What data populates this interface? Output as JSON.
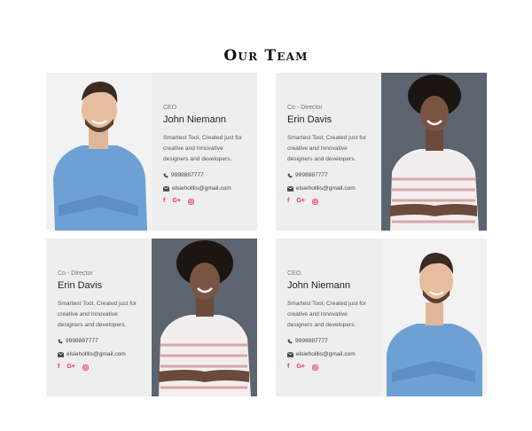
{
  "header": {
    "title": "Our Team"
  },
  "members": [
    {
      "role": "CEO",
      "name": "John Niemann",
      "description": "Smartest Tool, Created just for creative and Innovative designers and developers.",
      "phone": "9998887777",
      "email": "elsieholllis@gmail.com",
      "social": [
        "f",
        "G+",
        "instagram-icon"
      ]
    },
    {
      "role": "Co - Director",
      "name": "Erin Davis",
      "description": "Smartest Tool, Created just for creative and Innovative designers and developers.",
      "phone": "9998887777",
      "email": "elsieholllis@gmail.com",
      "social": [
        "f",
        "G+",
        "instagram-icon"
      ]
    },
    {
      "role": "Co - Director",
      "name": "Erin Davis",
      "description": "Smartest Tool, Created just for creative and Innovative designers and developers.",
      "phone": "9998887777",
      "email": "elsieholllis@gmail.com",
      "social": [
        "f",
        "G+",
        "instagram-icon"
      ]
    },
    {
      "role": "CEO",
      "name": "John Niemann",
      "description": "Smartest Tool, Created just for creative and Innovative designers and developers.",
      "phone": "9998887777",
      "email": "elsieholllis@gmail.com",
      "social": [
        "f",
        "G+",
        "instagram-icon"
      ]
    }
  ],
  "colors": {
    "accent": "#e8365d",
    "card_bg": "#eeeeee",
    "photo_bg_dark": "#5b646f"
  }
}
